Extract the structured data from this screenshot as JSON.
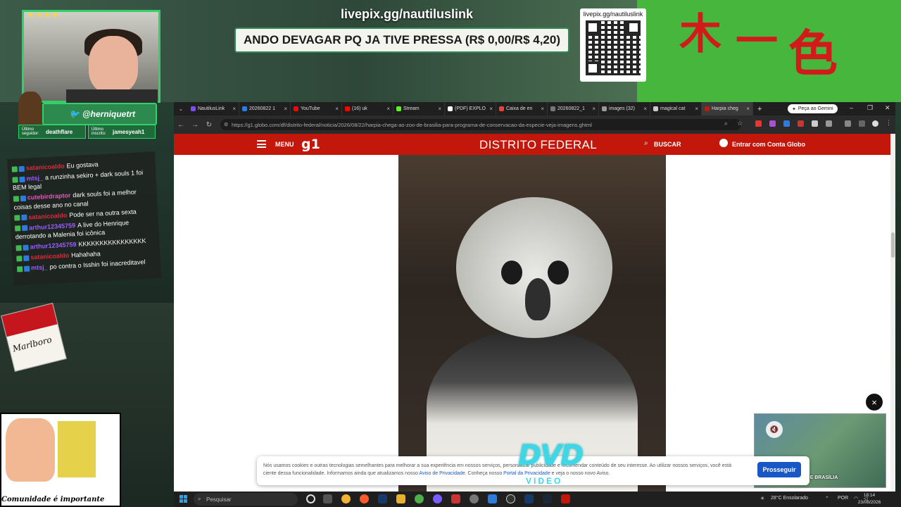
{
  "stream": {
    "livepix_url": "livepix.gg/nautiluslink",
    "pressa_banner": "ANDO DEVAGAR PQ JA TIVE PRESSA (R$ 0,00/R$ 4,20)",
    "qr_label": "livepix.gg/nautiluslink",
    "twitter_handle": "@herniquetrt",
    "last_follower_label": "Último seguidor:",
    "last_follower": "deathflare",
    "last_sub_label": "Último inscrito:",
    "last_sub": "jamesyeah1",
    "marlboro": "Marlboro",
    "meme_caption": "Comunidade é importante"
  },
  "chat": [
    {
      "user": "satanicoaldo",
      "color": "red",
      "text": "Eu gostava"
    },
    {
      "user": "mtsj_",
      "color": "pur",
      "text": "a runzinha sekiro + dark souls 1 foi BEM legal"
    },
    {
      "user": "cutebirdraptor",
      "color": "pink",
      "text": "dark souls foi a melhor coisas desse ano no canal"
    },
    {
      "user": "satanicoaldo",
      "color": "red",
      "text": "Pode ser na outra sexta"
    },
    {
      "user": "arthur12345759",
      "color": "pur",
      "text": "A live do Henrique derrotando a Malenia foi icônica"
    },
    {
      "user": "arthur12345759",
      "color": "pur",
      "text": "KKKKKKKKKKKKKKKK"
    },
    {
      "user": "satanicoaldo",
      "color": "red",
      "text": "Hahahaha"
    },
    {
      "user": "mtsj_",
      "color": "pur",
      "text": "po contra o Isshin foi inacreditavel"
    }
  ],
  "browser": {
    "tabs": [
      {
        "label": "NautilusLink",
        "color": "#7b4dff"
      },
      {
        "label": "20260822 1",
        "color": "#2a7de1"
      },
      {
        "label": "YouTube",
        "color": "#ff0000"
      },
      {
        "label": "(16) uk",
        "color": "#ff0000"
      },
      {
        "label": "Stream",
        "color": "#53fc18"
      },
      {
        "label": "(PDF) EXPLO",
        "color": "#ffffff"
      },
      {
        "label": "Caixa de en",
        "color": "#ea4335"
      },
      {
        "label": "20260822_1",
        "color": "#777777"
      },
      {
        "label": "images (32)",
        "color": "#999999"
      },
      {
        "label": "magical cat",
        "color": "#cccccc"
      },
      {
        "label": "Harpia cheg",
        "color": "#c4170c",
        "active": true
      }
    ],
    "new_tab": "+",
    "gemini_button": "Peça ao Gemini",
    "url": "https://g1.globo.com/df/distrito-federal/noticia/2026/08/22/harpia-chega-ao-zoo-de-brasilia-para-programa-de-conservacao-da-especie-veja-imagens.ghtml"
  },
  "g1": {
    "menu": "MENU",
    "logo": "g1",
    "section": "DISTRITO FEDERAL",
    "search": "BUSCAR",
    "login": "Entrar com Conta Globo"
  },
  "cookie": {
    "text_1": "Nós usamos cookies e outras tecnologias semelhantes para melhorar a sua experiência em nossos serviços, personalizar publicidade e recomendar conteúdo de seu interesse. Ao utilizar nossos serviços, você está ciente dessa funcionalidade. Informamos ainda que atualizamos nosso",
    "privacy_notice": "Aviso de Privacidade",
    "text_2": ". Conheça nosso",
    "privacy_portal": "Portal da Privacidade",
    "text_3": "e veja o nosso novo Aviso.",
    "button": "Prosseguir"
  },
  "overlay": {
    "close": "×",
    "video_caption": "NO ZOO DE BRASÍLIA",
    "dvd": "DVD",
    "dvd_sub": "VIDEO"
  },
  "taskbar": {
    "search_placeholder": "Pesquisar",
    "weather": "28°C Ensolarado",
    "lang": "POR",
    "time": "18:14",
    "date": "23/08/2026"
  }
}
